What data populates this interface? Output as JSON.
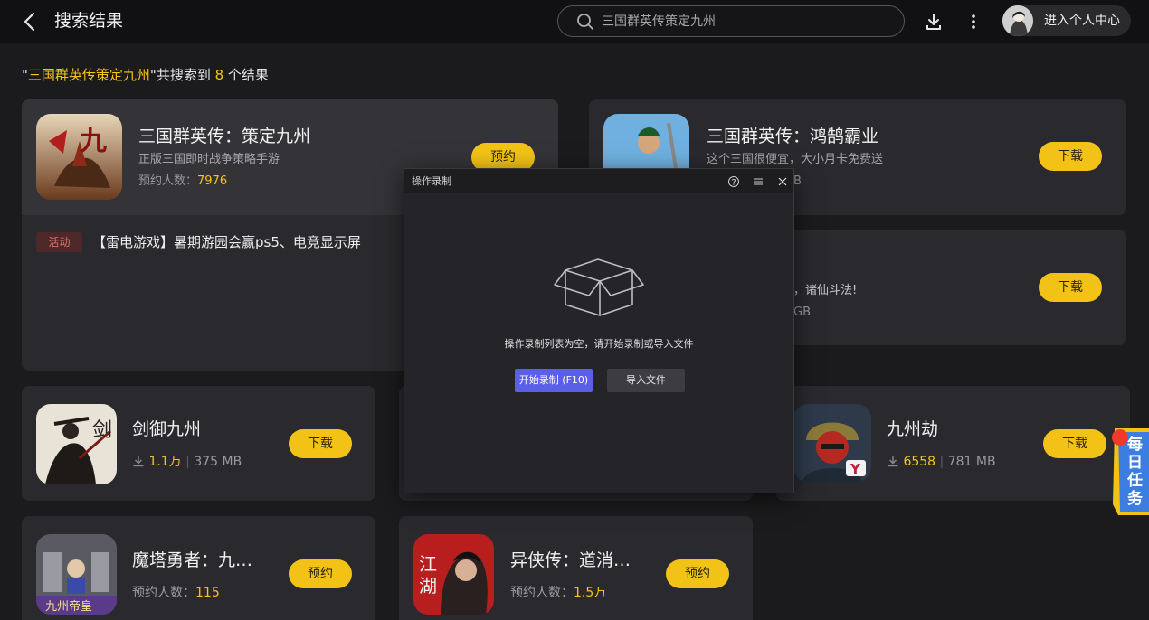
{
  "header": {
    "title": "搜索结果",
    "search_query": "三国群英传策定九州",
    "user_label": "进入个人中心"
  },
  "summary": {
    "prefix": "\"",
    "query": "三国群英传策定九州",
    "middle": "\"共搜索到 ",
    "count": "8",
    "suffix": " 个结果"
  },
  "results": [
    {
      "name": "三国群英传：策定九州",
      "desc": "正版三国即时战争策略手游",
      "stat_label": "预约人数：",
      "stat_value": "7976",
      "button": "预约",
      "tag": "活动",
      "activity": "【雷电游戏】暑期游园会赢ps5、电竞显示屏"
    },
    {
      "name": "三国群英传：鸿鹄霸业",
      "desc": "这个三国很便宜，大小月卡免费送",
      "size_tail": "B",
      "button": "下载"
    },
    {
      "desc_tail": "，诸仙斗法!",
      "size_tail": "GB",
      "button": "下载"
    },
    {
      "name": "剑御九州",
      "downloads": "1.1万",
      "size": "375 MB",
      "button": "下载"
    },
    {
      "name": "九州劫",
      "downloads": "6558",
      "size": "781 MB",
      "button": "下载"
    },
    {
      "name": "魔塔勇者：九…",
      "stat_label": "预约人数：",
      "stat_value": "115",
      "button": "预约"
    },
    {
      "name": "异侠传：道消…",
      "stat_label": "预约人数：",
      "stat_value": "1.5万",
      "button": "预约"
    }
  ],
  "modal": {
    "title": "操作录制",
    "empty_text": "操作录制列表为空，请开始录制或导入文件",
    "start_button": "开始录制 (F10)",
    "import_button": "导入文件"
  },
  "daily_task": {
    "chars": [
      "每",
      "日",
      "任",
      "务"
    ]
  },
  "colors": {
    "accent": "#f2c316",
    "highlight": "#f5c518",
    "modal_primary": "#5b5fe8",
    "tag_text": "#e06e6e"
  },
  "icons": [
    "back-icon",
    "search-icon",
    "download-icon",
    "more-icon",
    "help-icon",
    "menu-icon",
    "close-icon",
    "empty-box-icon"
  ]
}
